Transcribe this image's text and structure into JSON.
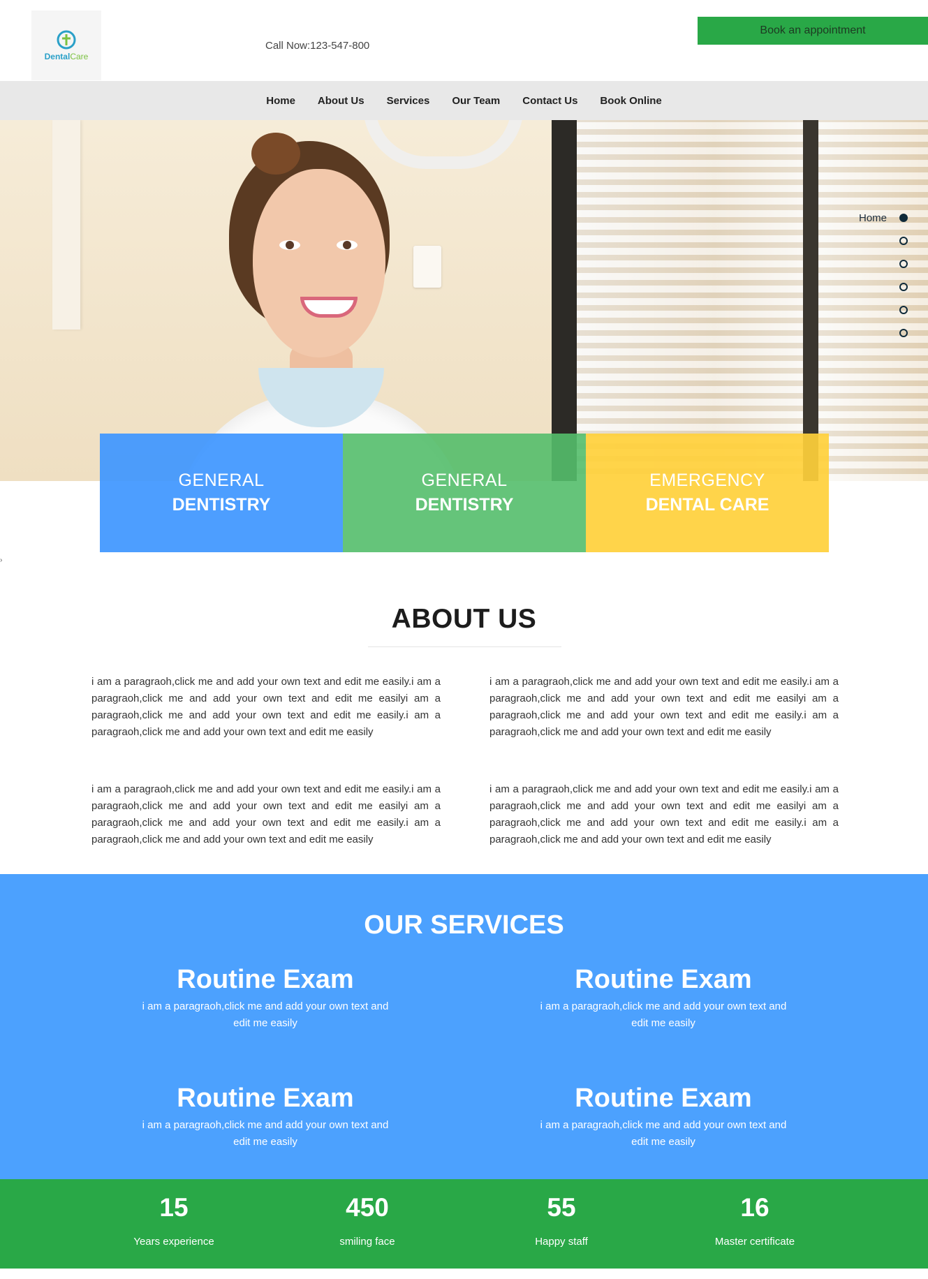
{
  "header": {
    "logo": {
      "name_part1": "Dental",
      "name_part2": "Care"
    },
    "call_text": "Call Now:123-547-800",
    "book_button": "Book an appointment"
  },
  "nav": {
    "items": [
      {
        "label": "Home"
      },
      {
        "label": "About Us"
      },
      {
        "label": "Services"
      },
      {
        "label": "Our Team"
      },
      {
        "label": "Contact Us"
      },
      {
        "label": "Book Online"
      }
    ]
  },
  "hero": {
    "section_label": "Home",
    "dot_count": 6,
    "active_dot": 0
  },
  "features": [
    {
      "line1": "GENERAL",
      "line2": "DENTISTRY",
      "color": "#3e96ff"
    },
    {
      "line1": "GENERAL",
      "line2": "DENTISTRY",
      "color": "#54be6c"
    },
    {
      "line1": "EMERGENCY",
      "line2": "DENTAL CARE",
      "color": "#ffd03b"
    }
  ],
  "about": {
    "title": "ABOUT US",
    "paragraphs": [
      "i am a paragraoh,click me and add your own text and edit me easily.i am a paragraoh,click me and add your own text and edit me easilyi am a paragraoh,click me and add your own text and edit me easily.i am a paragraoh,click me and add your own text and edit me easily",
      "i am a paragraoh,click me and add your own text and edit me easily.i am a paragraoh,click me and add your own text and edit me easilyi am a paragraoh,click me and add your own text and edit me easily.i am a paragraoh,click me and add your own text and edit me easily",
      "i am a paragraoh,click me and add your own text and edit me easily.i am a paragraoh,click me and add your own text and edit me easilyi am a paragraoh,click me and add your own text and edit me easily.i am a paragraoh,click me and add your own text and edit me easily",
      "i am a paragraoh,click me and add your own text and edit me easily.i am a paragraoh,click me and add your own text and edit me easilyi am a paragraoh,click me and add your own text and edit me easily.i am a paragraoh,click me and add your own text and edit me easily"
    ]
  },
  "services": {
    "title": "OUR SERVICES",
    "items": [
      {
        "heading": "Routine Exam",
        "text": "i am a paragraoh,click me and add your own text and edit me easily"
      },
      {
        "heading": "Routine Exam",
        "text": "i am a paragraoh,click me and add your own text and edit me easily"
      },
      {
        "heading": "Routine Exam",
        "text": "i am a paragraoh,click me and add your own text and edit me easily"
      },
      {
        "heading": "Routine Exam",
        "text": "i am a paragraoh,click me and add your own text and edit me easily"
      }
    ],
    "background_color": "#4ca1fe"
  },
  "stats": {
    "items": [
      {
        "number": "15",
        "label": "Years experience"
      },
      {
        "number": "450",
        "label": "smiling face"
      },
      {
        "number": "55",
        "label": "Happy staff"
      },
      {
        "number": "16",
        "label": "Master certificate"
      }
    ],
    "background_color": "#29a847"
  },
  "colors": {
    "accent_green": "#29a847",
    "accent_blue": "#4ca1fe",
    "nav_bg": "#e8e8e8"
  }
}
